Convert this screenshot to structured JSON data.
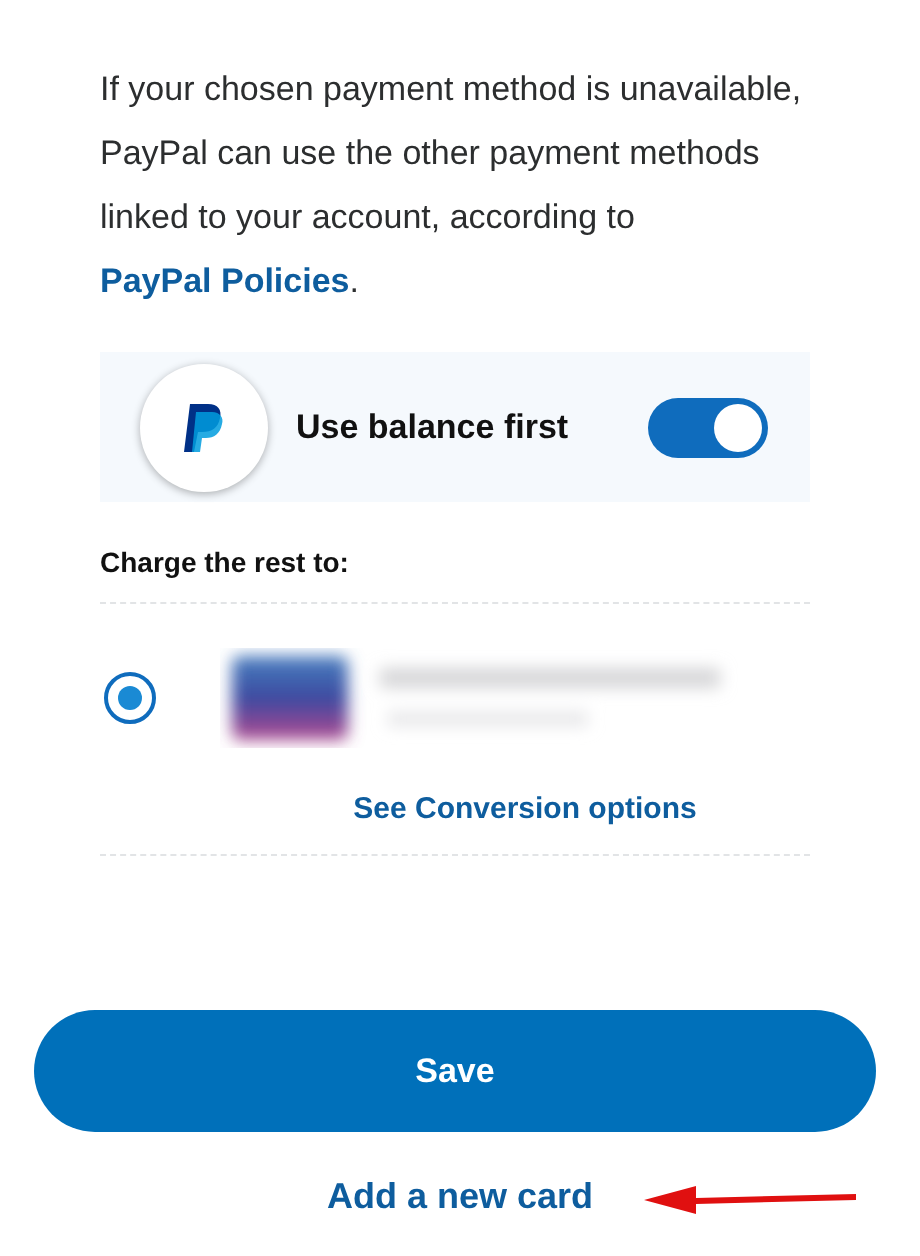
{
  "notice": {
    "text": "If your chosen payment method is unavailable, PayPal can use the other payment methods linked to your account, according to ",
    "link": "PayPal Policies",
    "end": "."
  },
  "balance": {
    "label": "Use balance first",
    "on": true
  },
  "charge_heading": "Charge the rest to:",
  "payment_options": [
    {
      "kind": "picture",
      "selected": true,
      "link": "See Conversion options"
    }
  ],
  "save_button": "Save",
  "add_card_link": "Add a new card"
}
